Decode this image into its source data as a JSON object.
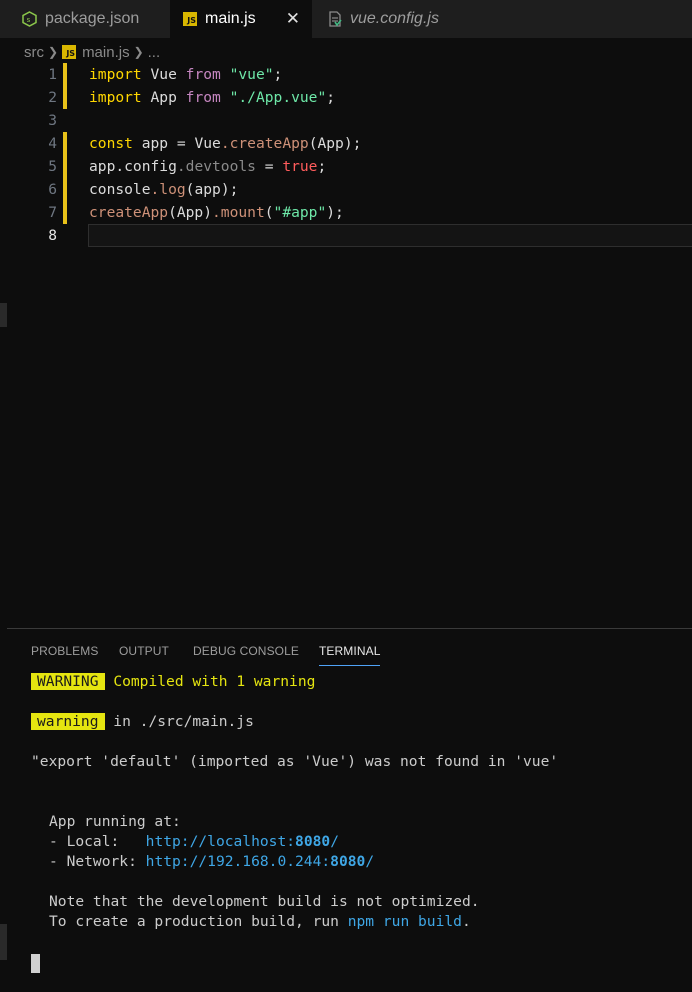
{
  "tabs": [
    {
      "label": "package.json",
      "icon": "node-icon",
      "active": false
    },
    {
      "label": "main.js",
      "icon": "js-icon",
      "active": true,
      "close": "✕"
    },
    {
      "label": "vue.config.js",
      "icon": "config-file-icon",
      "active": false
    }
  ],
  "breadcrumb": {
    "folder": "src",
    "file": "main.js",
    "more": "..."
  },
  "editor": {
    "line_numbers": [
      "1",
      "2",
      "3",
      "4",
      "5",
      "6",
      "7",
      "8"
    ],
    "lines": [
      [
        {
          "t": "import",
          "c": "kw-b"
        },
        {
          "t": " Vue ",
          "c": "wht"
        },
        {
          "t": "from",
          "c": "kw-p"
        },
        {
          "t": " ",
          "c": "wht"
        },
        {
          "t": "\"vue\"",
          "c": "grn"
        },
        {
          "t": ";",
          "c": "wht"
        }
      ],
      [
        {
          "t": "import",
          "c": "kw-b"
        },
        {
          "t": " App ",
          "c": "wht"
        },
        {
          "t": "from",
          "c": "kw-p"
        },
        {
          "t": " ",
          "c": "wht"
        },
        {
          "t": "\"./App.vue\"",
          "c": "grn"
        },
        {
          "t": ";",
          "c": "wht"
        }
      ],
      [],
      [
        {
          "t": "const",
          "c": "kw-b"
        },
        {
          "t": " app ",
          "c": "wht"
        },
        {
          "t": "=",
          "c": "wht"
        },
        {
          "t": " Vue",
          "c": "wht"
        },
        {
          "t": ".createApp",
          "c": "str"
        },
        {
          "t": "(App);",
          "c": "wht"
        }
      ],
      [
        {
          "t": "app.config",
          "c": "wht"
        },
        {
          "t": ".devtools",
          "c": "prop"
        },
        {
          "t": " = ",
          "c": "wht"
        },
        {
          "t": "true",
          "c": "red"
        },
        {
          "t": ";",
          "c": "wht"
        }
      ],
      [
        {
          "t": "console",
          "c": "wht"
        },
        {
          "t": ".log",
          "c": "str"
        },
        {
          "t": "(app);",
          "c": "wht"
        }
      ],
      [
        {
          "t": "createApp",
          "c": "str"
        },
        {
          "t": "(App)",
          "c": "wht"
        },
        {
          "t": ".mount",
          "c": "str"
        },
        {
          "t": "(",
          "c": "wht"
        },
        {
          "t": "\"#app\"",
          "c": "grn"
        },
        {
          "t": ");",
          "c": "wht"
        }
      ],
      []
    ]
  },
  "panel": {
    "tabs": [
      "PROBLEMS",
      "OUTPUT",
      "DEBUG CONSOLE",
      "TERMINAL"
    ],
    "terminal": {
      "warning_badge": "WARNING",
      "compiled": "Compiled with 1 warning",
      "warning_small": "warning",
      "in_file": " in ./src/main.js",
      "export_msg": "\"export 'default' (imported as 'Vue') was not found in 'vue'",
      "running": "App running at:",
      "local_label": "- Local:   ",
      "local_url": "http://localhost:",
      "local_port": "8080",
      "local_slash": "/",
      "network_label": "- Network: ",
      "network_url": "http://192.168.0.244:",
      "network_port": "8080",
      "network_slash": "/",
      "note": "Note that the development build is not optimized.",
      "prod_prefix": "To create a production build, run ",
      "prod_cmd": "npm run build",
      "prod_suffix": "."
    }
  }
}
